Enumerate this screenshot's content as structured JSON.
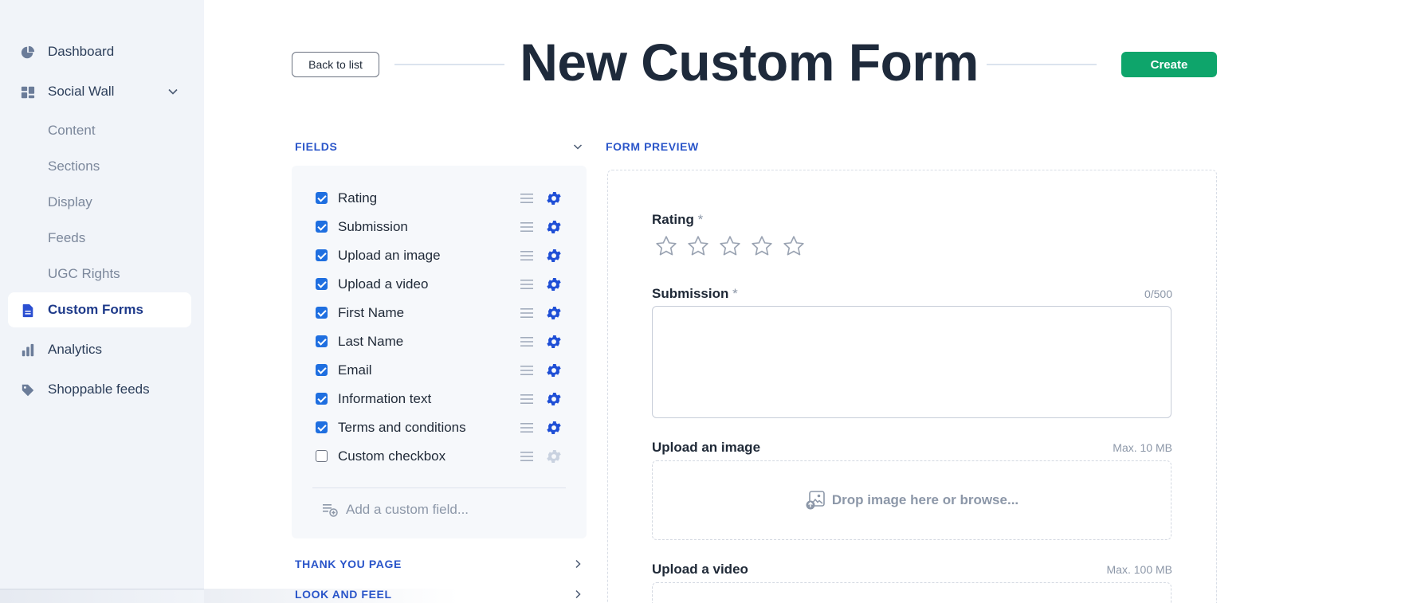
{
  "sidebar": {
    "items": [
      {
        "label": "Dashboard",
        "icon": "pie-chart-icon"
      },
      {
        "label": "Social Wall",
        "icon": "social-wall-icon",
        "expanded": true,
        "children": [
          "Content",
          "Sections",
          "Display",
          "Feeds",
          "UGC Rights"
        ]
      },
      {
        "label": "Custom Forms",
        "icon": "document-icon",
        "active": true
      },
      {
        "label": "Analytics",
        "icon": "bar-chart-icon"
      },
      {
        "label": "Shoppable feeds",
        "icon": "tag-icon"
      }
    ]
  },
  "header": {
    "back_label": "Back to list",
    "title": "New Custom Form",
    "create_label": "Create"
  },
  "fields_section": {
    "title": "FIELDS",
    "fields": [
      {
        "label": "Rating",
        "checked": true
      },
      {
        "label": "Submission",
        "checked": true
      },
      {
        "label": "Upload an image",
        "checked": true
      },
      {
        "label": "Upload a video",
        "checked": true
      },
      {
        "label": "First Name",
        "checked": true
      },
      {
        "label": "Last Name",
        "checked": true
      },
      {
        "label": "Email",
        "checked": true
      },
      {
        "label": "Information text",
        "checked": true
      },
      {
        "label": "Terms and conditions",
        "checked": true
      },
      {
        "label": "Custom checkbox",
        "checked": false
      }
    ],
    "add_custom_label": "Add a custom field..."
  },
  "thank_you_section": {
    "title": "THANK YOU PAGE"
  },
  "look_feel_section": {
    "title": "LOOK AND FEEL"
  },
  "preview": {
    "title": "FORM PREVIEW",
    "rating": {
      "label": "Rating",
      "required_mark": "*",
      "stars": 5
    },
    "submission": {
      "label": "Submission",
      "required_mark": "*",
      "counter": "0/500"
    },
    "upload_image": {
      "label": "Upload an image",
      "max": "Max. 10 MB",
      "drop_text": "Drop image here or browse..."
    },
    "upload_video": {
      "label": "Upload a video",
      "max": "Max. 100 MB"
    }
  },
  "colors": {
    "accent": "#2a55c9",
    "create": "#0ea56b",
    "checkbox": "#1f6fe0",
    "gear": "#1f4fd6"
  }
}
